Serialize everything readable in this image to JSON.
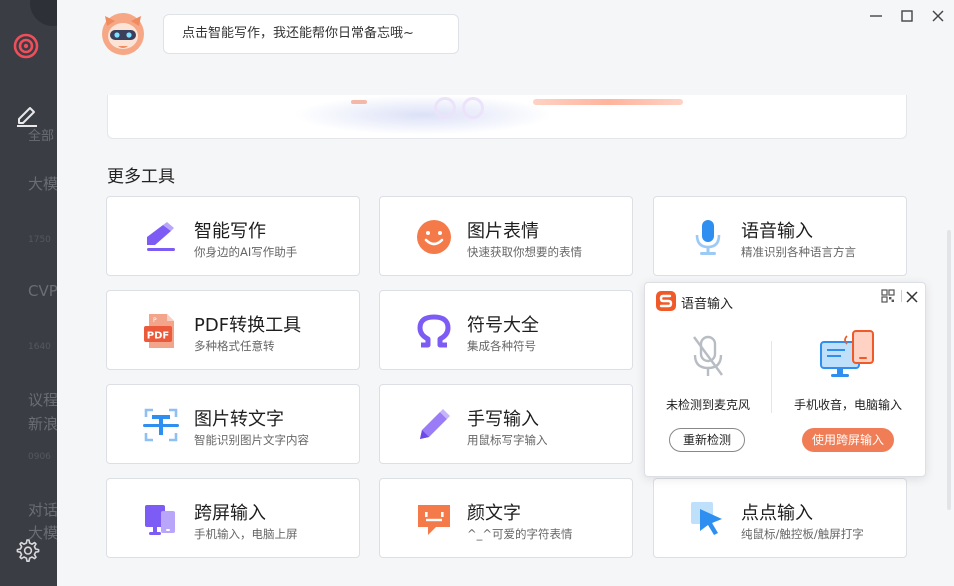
{
  "assistant": {
    "greeting": "点击智能写作，我还能帮你日常备忘哦~"
  },
  "sidebar": {
    "items": [
      {
        "label": "全部"
      },
      {
        "label": "大模"
      },
      {
        "label": "CVP"
      },
      {
        "label": "议程"
      },
      {
        "label": "新浪"
      },
      {
        "label": "对话"
      },
      {
        "label": "大模"
      }
    ],
    "faint": [
      "1750",
      "1640",
      "0906"
    ]
  },
  "section": {
    "title": "更多工具"
  },
  "tools": [
    {
      "title": "智能写作",
      "subtitle": "你身边的AI写作助手",
      "icon": "ai-writing-icon"
    },
    {
      "title": "图片表情",
      "subtitle": "快速获取你想要的表情",
      "icon": "emoji-icon"
    },
    {
      "title": "语音输入",
      "subtitle": "精准识别各种语言方言",
      "icon": "microphone-icon"
    },
    {
      "title": "PDF转换工具",
      "subtitle": "多种格式任意转",
      "icon": "pdf-icon"
    },
    {
      "title": "符号大全",
      "subtitle": "集成各种符号",
      "icon": "omega-icon"
    },
    {
      "title": "图片转文字",
      "subtitle": "智能识别图片文字内容",
      "icon": "ocr-icon"
    },
    {
      "title": "手写输入",
      "subtitle": "用鼠标写字输入",
      "icon": "pen-icon"
    },
    {
      "title": "跨屏输入",
      "subtitle": "手机输入，电脑上屏",
      "icon": "cross-screen-icon"
    },
    {
      "title": "颜文字",
      "subtitle": "^_^可爱的字符表情",
      "icon": "kaomoji-icon"
    },
    {
      "title": "点点输入",
      "subtitle": "纯鼠标/触控板/触屏打字",
      "icon": "cursor-icon"
    }
  ],
  "voice_popup": {
    "title": "语音输入",
    "no_mic_label": "未检测到麦克风",
    "phone_label": "手机收音，电脑输入",
    "recheck_button": "重新检测",
    "use_cross_button": "使用跨屏输入"
  },
  "colors": {
    "sidebar_bg": "#3a3d44",
    "accent_orange": "#f07d55",
    "accent_purple": "#8b5cf6",
    "accent_blue": "#2f8ff0"
  }
}
